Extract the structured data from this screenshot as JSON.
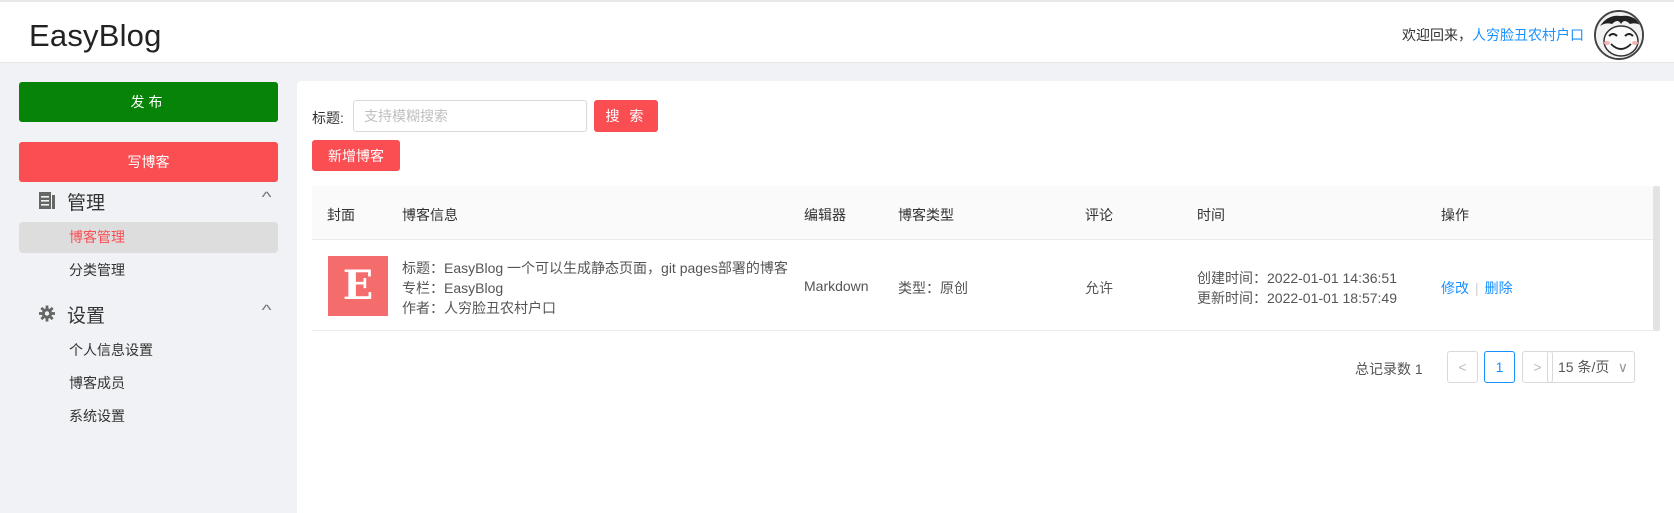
{
  "header": {
    "logo": "EasyBlog",
    "welcome": "欢迎回来，",
    "username": "人穷脸丑农村户口"
  },
  "sidebar": {
    "publish_label": "发布",
    "write_label": "写博客",
    "groups": [
      {
        "title": "管理",
        "icon": "document-icon",
        "items": [
          "博客管理",
          "分类管理"
        ]
      },
      {
        "title": "设置",
        "icon": "gear-icon",
        "items": [
          "个人信息设置",
          "博客成员",
          "系统设置"
        ]
      }
    ],
    "active_item": "博客管理"
  },
  "search": {
    "label": "标题:",
    "placeholder": "支持模糊搜索",
    "value": "",
    "button": "搜 索"
  },
  "add_button": "新增博客",
  "table": {
    "columns": [
      "封面",
      "博客信息",
      "编辑器",
      "博客类型",
      "评论",
      "时间",
      "操作"
    ],
    "rows": [
      {
        "cover_letter": "E",
        "title_line": "标题：EasyBlog 一个可以生成静态页面，git pages部署的博客",
        "column_line": "专栏：EasyBlog",
        "author_line": "作者：人穷脸丑农村户口",
        "editor": "Markdown",
        "type": "类型：原创",
        "comment": "允许",
        "created": "创建时间：2022-01-01 14:36:51",
        "updated": "更新时间：2022-01-01 18:57:49",
        "edit": "修改",
        "delete": "删除"
      }
    ]
  },
  "pagination": {
    "total": "总记录数 1",
    "prev": "<",
    "current": "1",
    "next": ">",
    "page_size": "15 条/页"
  },
  "colors": {
    "publish": "#078307",
    "accent": "#fb4e53",
    "link": "#1890ff",
    "cover": "#f56c6c"
  }
}
